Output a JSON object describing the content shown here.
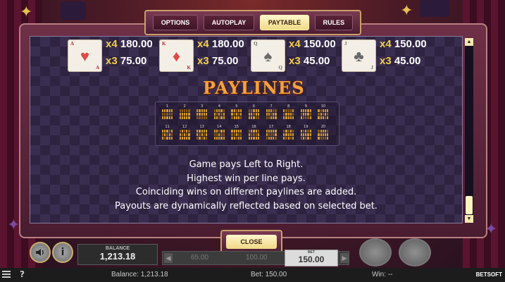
{
  "tabs": [
    {
      "label": "OPTIONS",
      "active": false
    },
    {
      "label": "AUTOPLAY",
      "active": false
    },
    {
      "label": "PAYTABLE",
      "active": true
    },
    {
      "label": "RULES",
      "active": false
    }
  ],
  "symbols": [
    {
      "rank": "A",
      "suit": "♥",
      "suit_name": "heart-icon",
      "color": "red",
      "pays": [
        {
          "mult": "x4",
          "value": "180.00"
        },
        {
          "mult": "x3",
          "value": "75.00"
        }
      ]
    },
    {
      "rank": "K",
      "suit": "♦",
      "suit_name": "diamond-icon",
      "color": "red",
      "pays": [
        {
          "mult": "x4",
          "value": "180.00"
        },
        {
          "mult": "x3",
          "value": "75.00"
        }
      ]
    },
    {
      "rank": "Q",
      "suit": "♠",
      "suit_name": "spade-icon",
      "color": "black",
      "pays": [
        {
          "mult": "x4",
          "value": "150.00"
        },
        {
          "mult": "x3",
          "value": "45.00"
        }
      ]
    },
    {
      "rank": "J",
      "suit": "♣",
      "suit_name": "club-icon",
      "color": "black",
      "pays": [
        {
          "mult": "x4",
          "value": "150.00"
        },
        {
          "mult": "x3",
          "value": "45.00"
        }
      ]
    }
  ],
  "paylines_title": "PAYLINES",
  "paylines": [
    {
      "num": "1",
      "rows": [
        1,
        1,
        1,
        1,
        1
      ]
    },
    {
      "num": "2",
      "rows": [
        0,
        0,
        0,
        0,
        0
      ]
    },
    {
      "num": "3",
      "rows": [
        2,
        2,
        2,
        2,
        2
      ]
    },
    {
      "num": "4",
      "rows": [
        0,
        1,
        2,
        1,
        0
      ]
    },
    {
      "num": "5",
      "rows": [
        2,
        1,
        0,
        1,
        2
      ]
    },
    {
      "num": "6",
      "rows": [
        0,
        0,
        1,
        2,
        2
      ]
    },
    {
      "num": "7",
      "rows": [
        2,
        2,
        1,
        0,
        0
      ]
    },
    {
      "num": "8",
      "rows": [
        1,
        0,
        0,
        0,
        1
      ]
    },
    {
      "num": "9",
      "rows": [
        1,
        2,
        2,
        2,
        1
      ]
    },
    {
      "num": "10",
      "rows": [
        1,
        0,
        1,
        2,
        1
      ]
    },
    {
      "num": "11",
      "rows": [
        1,
        2,
        1,
        0,
        1
      ]
    },
    {
      "num": "12",
      "rows": [
        0,
        1,
        0,
        1,
        0
      ]
    },
    {
      "num": "13",
      "rows": [
        2,
        1,
        2,
        1,
        2
      ]
    },
    {
      "num": "14",
      "rows": [
        1,
        1,
        0,
        1,
        1
      ]
    },
    {
      "num": "15",
      "rows": [
        1,
        1,
        2,
        1,
        1
      ]
    },
    {
      "num": "16",
      "rows": [
        0,
        1,
        1,
        1,
        0
      ]
    },
    {
      "num": "17",
      "rows": [
        2,
        1,
        1,
        1,
        2
      ]
    },
    {
      "num": "18",
      "rows": [
        0,
        2,
        0,
        2,
        0
      ]
    },
    {
      "num": "19",
      "rows": [
        2,
        0,
        2,
        0,
        2
      ]
    },
    {
      "num": "20",
      "rows": [
        0,
        2,
        2,
        2,
        0
      ]
    }
  ],
  "rules_text": [
    "Game pays Left to Right.",
    "Highest win per line pays.",
    "Coinciding wins on different paylines are added.",
    "Payouts are dynamically reflected based on selected bet."
  ],
  "close_label": "CLOSE",
  "controls": {
    "balance_label": "BALANCE",
    "balance_value": "1,213.18",
    "bet_options": [
      "65.00",
      "100.00"
    ],
    "bet_label": "BET",
    "bet_value": "150.00",
    "sound_icon": "speaker-icon",
    "info_icon": "info-icon",
    "info_glyph": "i"
  },
  "status": {
    "balance": "Balance: 1,213.18",
    "bet": "Bet: 150.00",
    "win": "Win: --",
    "brand": "BETSOFT",
    "help_glyph": "?"
  },
  "colors": {
    "accent_gold": "#f2cf4a",
    "paylines_title": "#f4a23c",
    "active_tab": "#f0d985",
    "panel": "#4a1c30"
  }
}
